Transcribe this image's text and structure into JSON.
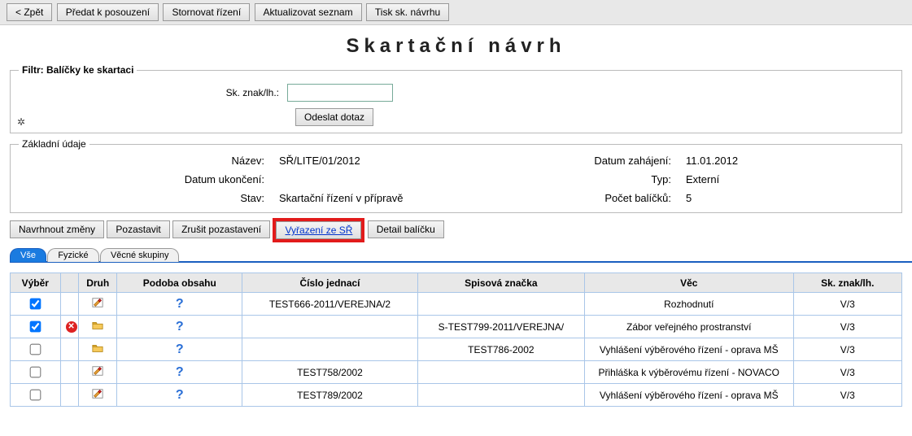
{
  "topbar": {
    "back": "< Zpět",
    "predat": "Předat k posouzení",
    "stornovat": "Stornovat řízení",
    "aktualizovat": "Aktualizovat seznam",
    "tisk": "Tisk sk. návrhu"
  },
  "page_title": "Skartační návrh",
  "filter": {
    "legend": "Filtr: Balíčky ke skartaci",
    "sk_znak_label": "Sk. znak/lh.:",
    "sk_znak_value": "",
    "submit": "Odeslat dotaz"
  },
  "basic": {
    "legend": "Základní údaje",
    "labels": {
      "nazev": "Název:",
      "datum_zahajeni": "Datum zahájení:",
      "datum_ukonceni": "Datum ukončení:",
      "typ": "Typ:",
      "stav": "Stav:",
      "pocet": "Počet balíčků:"
    },
    "values": {
      "nazev": "SŘ/LITE/01/2012",
      "datum_zahajeni": "11.01.2012",
      "datum_ukonceni": "",
      "typ": "Externí",
      "stav": "Skartační řízení v přípravě",
      "pocet": "5"
    }
  },
  "actions": {
    "navrhnout": "Navrhnout změny",
    "pozastavit": "Pozastavit",
    "zrusit": "Zrušit pozastavení",
    "vyrazeni": "Vyřazení ze SŘ",
    "detail": "Detail balíčku"
  },
  "tabs": {
    "vse": "Vše",
    "fyzicke": "Fyzické",
    "vecne": "Věcné skupiny"
  },
  "grid": {
    "headers": {
      "vyber": "Výběr",
      "flag": "",
      "druh": "Druh",
      "podoba": "Podoba obsahu",
      "cj": "Číslo jednací",
      "spis": "Spisová značka",
      "vec": "Věc",
      "znak": "Sk. znak/lh."
    },
    "rows": [
      {
        "checked": true,
        "flag": "",
        "druh": "edit",
        "cj": "TEST666-2011/VEREJNA/2",
        "spis": "",
        "vec": "Rozhodnutí",
        "znak": "V/3"
      },
      {
        "checked": true,
        "flag": "del",
        "druh": "folder",
        "cj": "",
        "spis": "S-TEST799-2011/VEREJNA/",
        "vec": "Zábor veřejného prostranství",
        "znak": "V/3"
      },
      {
        "checked": false,
        "flag": "",
        "druh": "folder",
        "cj": "",
        "spis": "TEST786-2002",
        "vec": "Vyhlášení výběrového řízení - oprava MŠ",
        "znak": "V/3"
      },
      {
        "checked": false,
        "flag": "",
        "druh": "edit",
        "cj": "TEST758/2002",
        "spis": "",
        "vec": "Přihláška k výběrovému řízení - NOVACO",
        "znak": "V/3"
      },
      {
        "checked": false,
        "flag": "",
        "druh": "edit",
        "cj": "TEST789/2002",
        "spis": "",
        "vec": "Vyhlášení výběrového řízení - oprava MŠ",
        "znak": "V/3"
      }
    ]
  }
}
